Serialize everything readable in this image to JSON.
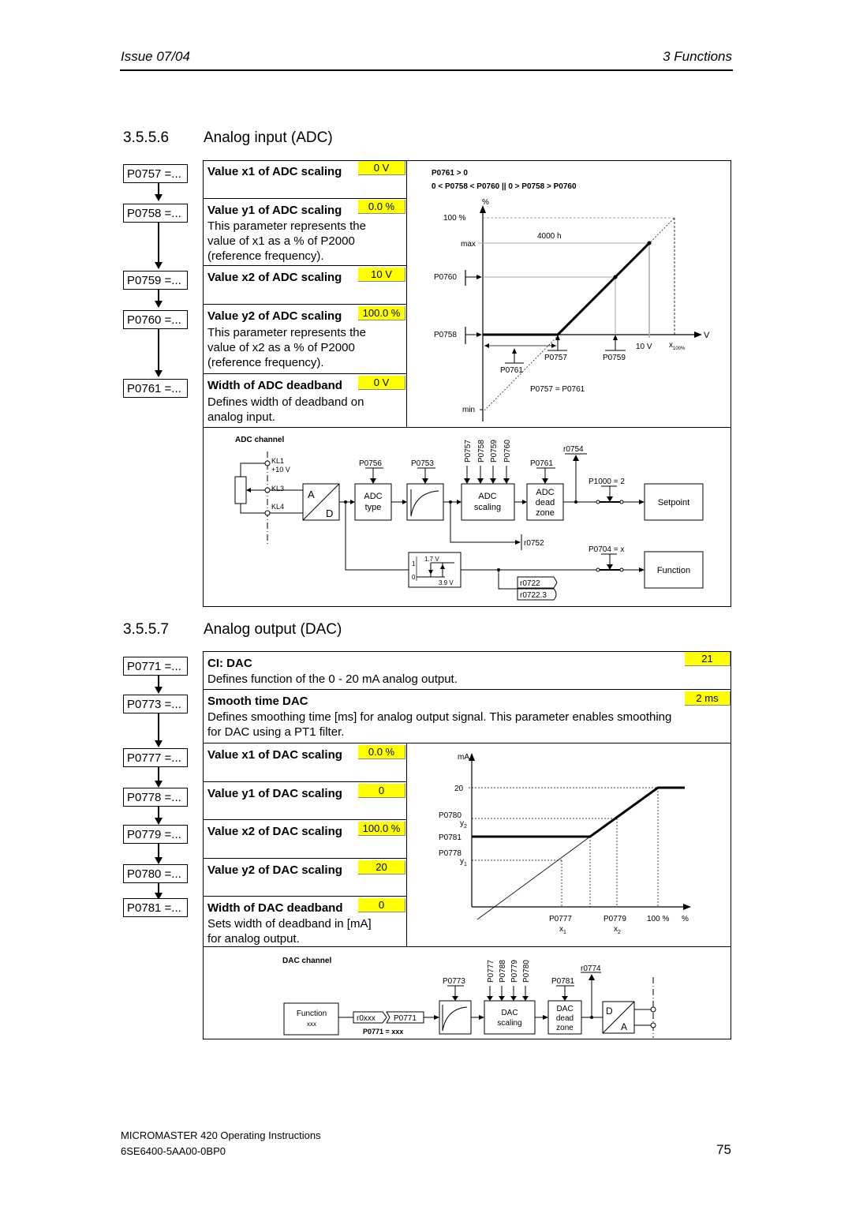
{
  "header": {
    "left": "Issue 07/04",
    "right": "3  Functions"
  },
  "adc": {
    "section_number": "3.5.5.6",
    "section_title": "Analog input (ADC)",
    "params": [
      {
        "code": "P0757 =...",
        "title": "Value x1 of ADC scaling",
        "value": "0 V",
        "desc": ""
      },
      {
        "code": "P0758 =...",
        "title": "Value y1 of ADC scaling",
        "value": "0.0 %",
        "desc": [
          "This parameter represents the",
          "value of x1 as a % of P2000",
          "(reference frequency)."
        ]
      },
      {
        "code": "P0759 =...",
        "title": "Value x2 of ADC scaling",
        "value": "10 V",
        "desc": ""
      },
      {
        "code": "P0760 =...",
        "title": "Value y2 of ADC scaling",
        "value": "100.0 %",
        "desc": [
          "This parameter represents the",
          "value of x2 as a % of P2000",
          "(reference frequency)."
        ]
      },
      {
        "code": "P0761 =...",
        "title": "Width of ADC deadband",
        "value": "0 V",
        "desc": [
          "Defines width of deadband on",
          "analog input."
        ]
      }
    ],
    "graph": {
      "cond1": "P0761 > 0",
      "cond2": "0 < P0758 < P0760  ||  0 > P0758 > P0760",
      "y_unit": "%",
      "x_unit": "V",
      "y_100": "100 %",
      "y_max": "max",
      "y_p0760": "P0760",
      "y_p0758": "P0758",
      "y_min": "min",
      "label_4000h": "4000 h",
      "x_10v": "10 V",
      "x_100": "x",
      "x_100_sub": "100%",
      "x_p0757": "P0757",
      "x_p0759": "P0759",
      "x_p0761": "P0761",
      "eq": "P0757 = P0761"
    },
    "channel": {
      "title": "ADC channel",
      "kl1": "KL1",
      "plus10": "+10 V",
      "kl3": "KL3",
      "kl4": "KL4",
      "ad_a": "A",
      "ad_d": "D",
      "p0756": "P0756",
      "adc_type_1": "ADC",
      "adc_type_2": "type",
      "p0753": "P0753",
      "scal_params": [
        "P0757",
        "P0758",
        "P0759",
        "P0760"
      ],
      "adc_scaling_1": "ADC",
      "adc_scaling_2": "scaling",
      "p0761": "P0761",
      "dz_1": "ADC",
      "dz_2": "dead",
      "dz_3": "zone",
      "r0754": "r0754",
      "p1000": "P1000 = 2",
      "setpoint": "Setpoint",
      "r0752": "r0752",
      "p0704": "P0704 = x",
      "function": "Function",
      "hyst_1": "1",
      "hyst_0": "0",
      "hyst_17": "1.7 V",
      "hyst_39": "3.9 V",
      "r0722": "r0722",
      "r07223": "r0722.3"
    }
  },
  "dac": {
    "section_number": "3.5.5.7",
    "section_title": "Analog output (DAC)",
    "wide_params": [
      {
        "code": "P0771 =...",
        "title": "CI: DAC",
        "value": "21",
        "desc": [
          "Defines function of the 0 - 20 mA analog output."
        ]
      },
      {
        "code": "P0773 =...",
        "title": "Smooth time DAC",
        "value": "2 ms",
        "desc": [
          "Defines smoothing time [ms] for analog output signal. This parameter enables smoothing",
          "for DAC using a PT1 filter."
        ]
      }
    ],
    "params": [
      {
        "code": "P0777 =...",
        "title": "Value x1 of DAC scaling",
        "value": "0.0 %",
        "desc": ""
      },
      {
        "code": "P0778 =...",
        "title": "Value y1 of DAC scaling",
        "value": "0",
        "desc": ""
      },
      {
        "code": "P0779 =...",
        "title": "Value x2 of DAC scaling",
        "value": "100.0 %",
        "desc": ""
      },
      {
        "code": "P0780 =...",
        "title": "Value y2 of DAC scaling",
        "value": "20",
        "desc": ""
      },
      {
        "code": "P0781 =...",
        "title": "Width of DAC deadband",
        "value": "0",
        "desc": [
          "Sets width of deadband in [mA]",
          "for analog output."
        ]
      }
    ],
    "graph": {
      "y_unit": "mA",
      "x_unit": "%",
      "y_20": "20",
      "y_p0780": "P0780",
      "y_y2": "y",
      "y_y2_sub": "2",
      "y_p0781": "P0781",
      "y_p0778": "P0778",
      "y_y1": "y",
      "y_y1_sub": "1",
      "x_p0777": "P0777",
      "x_x1": "x",
      "x_x1_sub": "1",
      "x_p0779": "P0779",
      "x_x2": "x",
      "x_x2_sub": "2",
      "x_100": "100 %"
    },
    "channel": {
      "title": "DAC channel",
      "func_1": "Function",
      "func_2": "xxx",
      "r0xxx": "r0xxx",
      "p0771": "P0771",
      "p0771_eq": "P0771 = xxx",
      "p0773": "P0773",
      "scal_params": [
        "P0777",
        "P0788",
        "P0779",
        "P0780"
      ],
      "dac_scaling_1": "DAC",
      "dac_scaling_2": "scaling",
      "p0781": "P0781",
      "dz_1": "DAC",
      "dz_2": "dead",
      "dz_3": "zone",
      "r0774": "r0774",
      "da_d": "D",
      "da_a": "A"
    }
  },
  "footer": {
    "product": "MICROMASTER 420    Operating Instructions",
    "order": "6SE6400-5AA00-0BP0",
    "page": "75"
  },
  "colors": {
    "value_highlight": "#ffff00"
  }
}
